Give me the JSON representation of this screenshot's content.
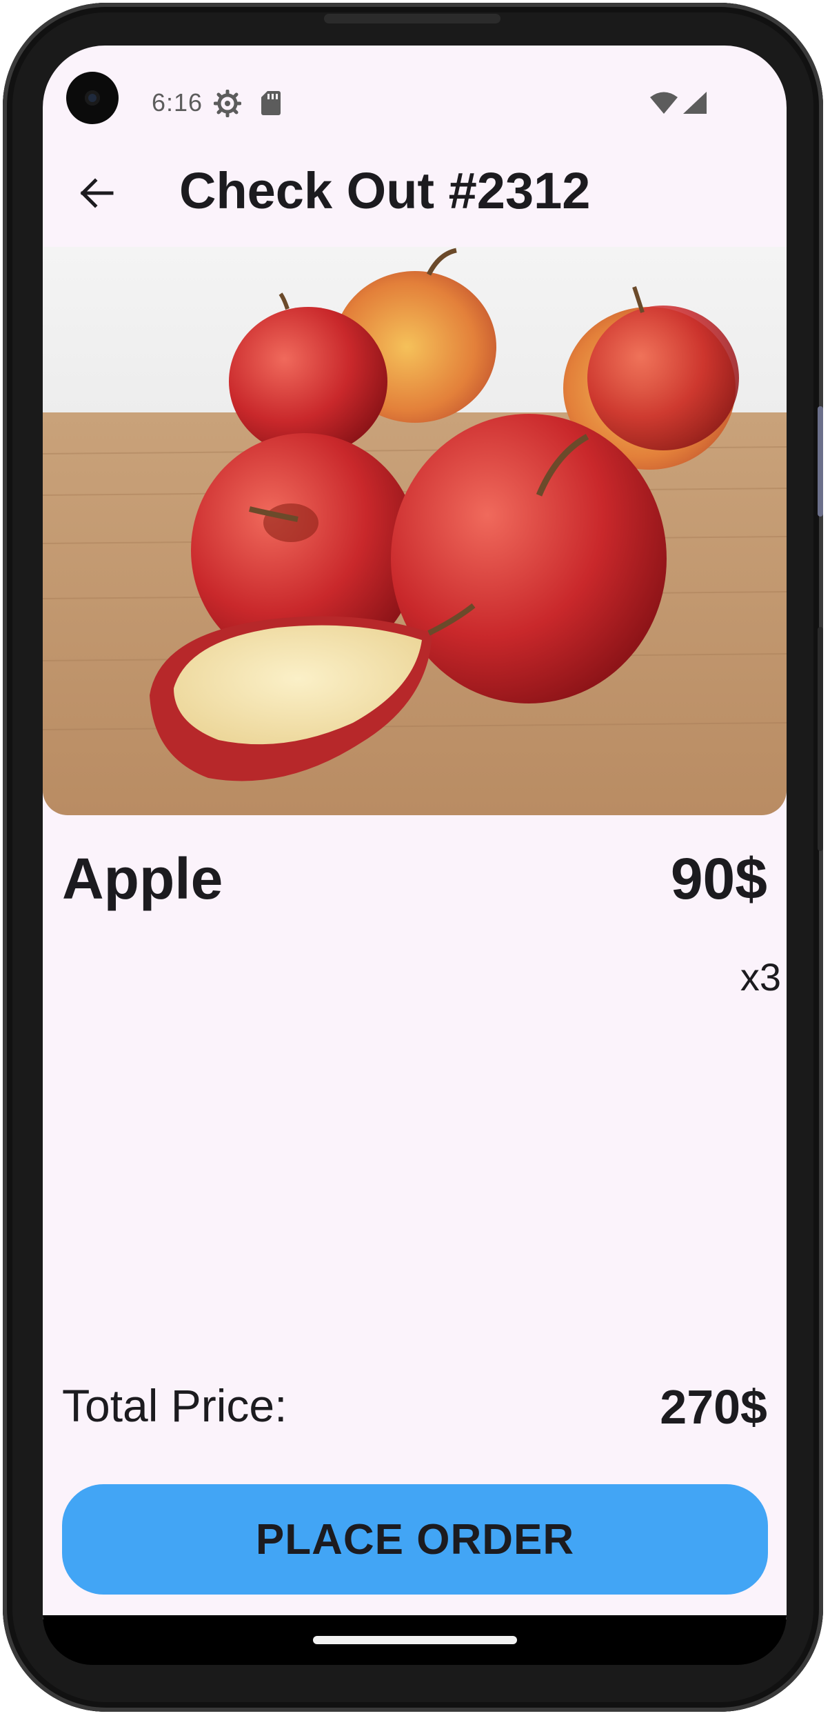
{
  "status_bar": {
    "time": "6:16",
    "icons": [
      "camera-cutout",
      "gear-icon",
      "sd-card-icon",
      "wifi-icon",
      "signal-icon"
    ]
  },
  "app_bar": {
    "title": "Check Out #2312",
    "back_icon": "arrow-left-icon"
  },
  "product": {
    "image_alt": "apples-photo",
    "name": "Apple",
    "price": "90$",
    "quantity": "x3"
  },
  "summary": {
    "total_label": "Total Price:",
    "total_value": "270$"
  },
  "actions": {
    "place_order_label": "PLACE ORDER"
  },
  "colors": {
    "screen_background": "#fbf3fb",
    "button_accent": "#42a5f5",
    "text": "#1c1b1f"
  }
}
